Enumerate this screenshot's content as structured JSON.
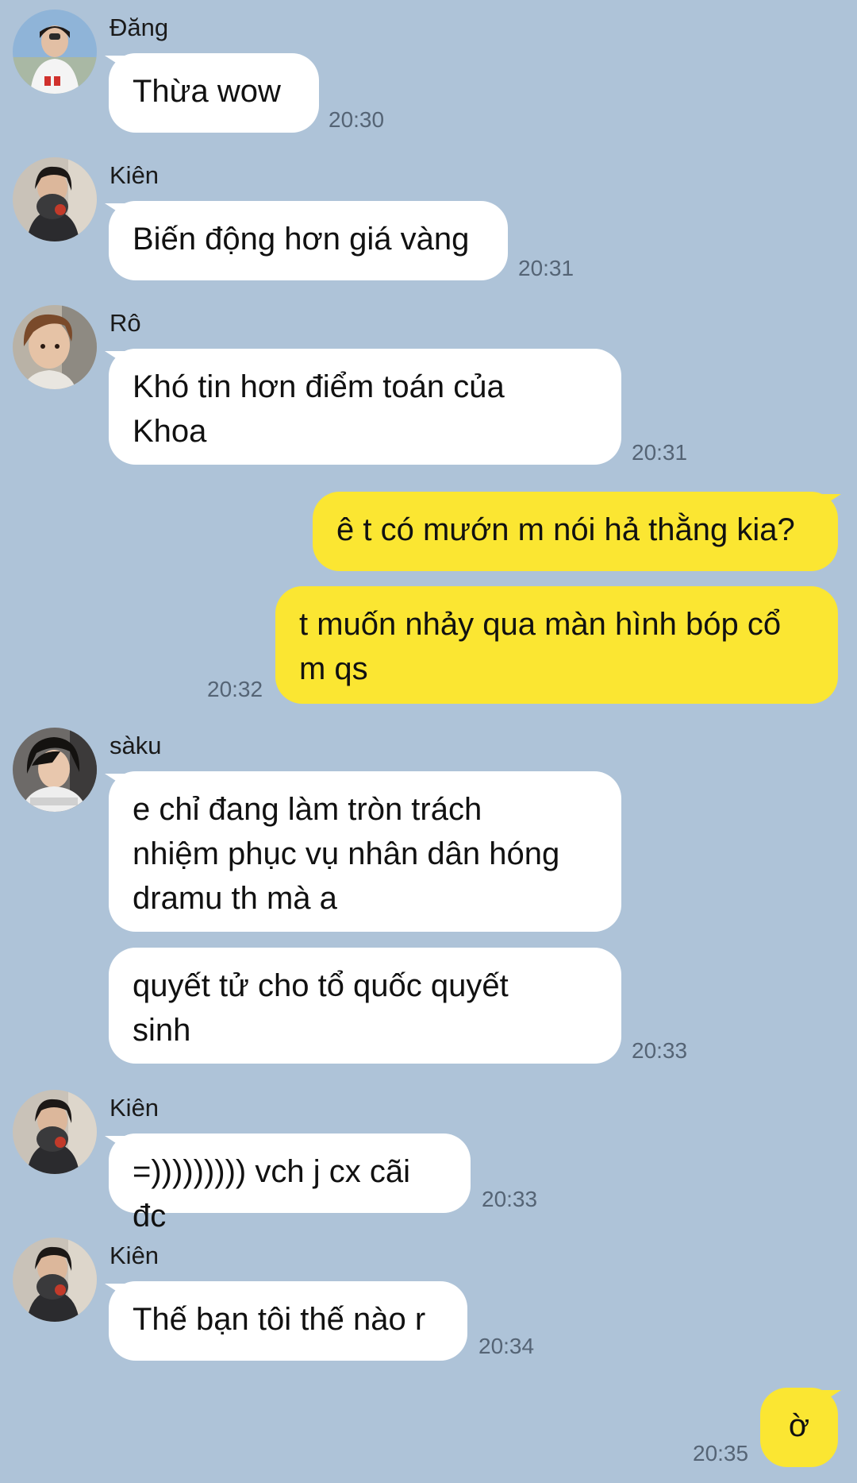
{
  "colors": {
    "background": "#aec3d8",
    "incoming_bubble": "#ffffff",
    "outgoing_bubble": "#fbe632",
    "timestamp": "#556475"
  },
  "messages": [
    {
      "sender": "Đăng",
      "text": "Thừa wow",
      "time": "20:30"
    },
    {
      "sender": "Kiên",
      "text": "Biến động hơn giá vàng",
      "time": "20:31"
    },
    {
      "sender": "Rô",
      "text": "Khó tin hơn điểm toán của\nKhoa",
      "time": "20:31"
    },
    {
      "text": "ê t có mướn m nói hả thằng kia?"
    },
    {
      "text": "t muốn nhảy qua màn hình bóp cổ\nm qs",
      "time": "20:32"
    },
    {
      "sender": "sàku",
      "text": "e chỉ đang làm tròn trách\nnhiệm phục vụ nhân dân hóng\ndramu th mà a"
    },
    {
      "text": "quyết tử cho tổ quốc quyết\nsinh",
      "time": "20:33"
    },
    {
      "sender": "Kiên",
      "text": "=))))))))) vch j cx cãi đc",
      "time": "20:33"
    },
    {
      "sender": "Kiên",
      "text": "Thế bạn tôi thế nào r",
      "time": "20:34"
    },
    {
      "text": "ờ",
      "time": "20:35"
    }
  ]
}
